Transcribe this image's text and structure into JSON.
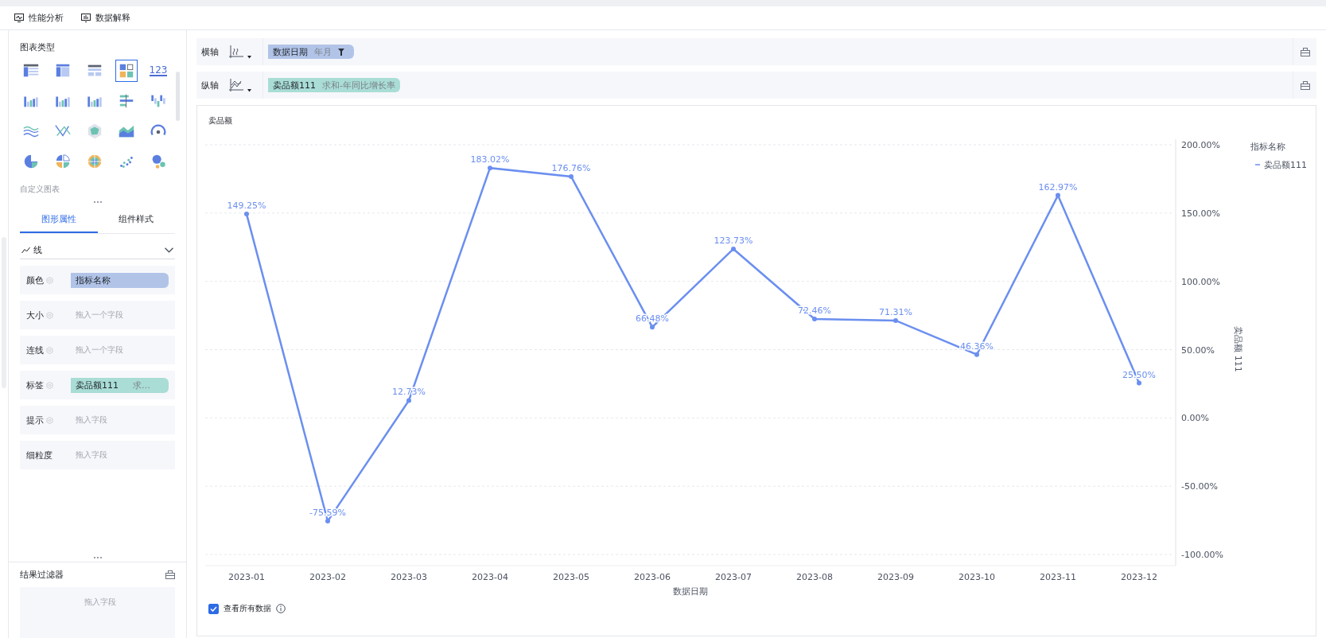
{
  "toolbar": [
    {
      "kind": "performance",
      "label": "性能分析"
    },
    {
      "kind": "explain",
      "label": "数据解释"
    }
  ],
  "chart_types": {
    "title": "图表类型",
    "items": [
      {
        "kind": "table",
        "selected": false
      },
      {
        "kind": "cross-table",
        "selected": false
      },
      {
        "kind": "detail-table",
        "selected": false
      },
      {
        "kind": "card",
        "selected": true
      },
      {
        "kind": "number",
        "label": "123",
        "selected": false
      },
      {
        "kind": "bar-group",
        "selected": false
      },
      {
        "kind": "bar-stack",
        "selected": false
      },
      {
        "kind": "column",
        "selected": false
      },
      {
        "kind": "bar-h",
        "selected": false
      },
      {
        "kind": "waterfall",
        "selected": false
      },
      {
        "kind": "wave",
        "selected": false
      },
      {
        "kind": "line-cross",
        "selected": false
      },
      {
        "kind": "radar",
        "selected": false
      },
      {
        "kind": "area",
        "selected": false
      },
      {
        "kind": "gauge",
        "selected": false
      },
      {
        "kind": "pie",
        "selected": false
      },
      {
        "kind": "split-pie",
        "selected": false
      },
      {
        "kind": "rose",
        "selected": false
      },
      {
        "kind": "scatter",
        "selected": false
      },
      {
        "kind": "bubble",
        "selected": false
      }
    ],
    "custom_label": "自定义图表"
  },
  "tabs": [
    {
      "label": "图形属性",
      "selected": true
    },
    {
      "label": "组件样式",
      "selected": false
    }
  ],
  "mark_type": {
    "label": "线"
  },
  "properties": [
    {
      "label": "颜色",
      "settings": true,
      "pill": {
        "text": "指标名称",
        "color": "#b1c4e8"
      }
    },
    {
      "label": "大小",
      "settings": true,
      "placeholder": "拖入一个字段"
    },
    {
      "label": "连线",
      "settings": true,
      "placeholder": "拖入一个字段"
    },
    {
      "label": "标签",
      "settings": true,
      "pill": {
        "text": "卖品额111",
        "suffix": "求…",
        "color": "#a9ddd6"
      }
    },
    {
      "label": "提示",
      "settings": true,
      "placeholder": "拖入字段"
    },
    {
      "label": "细粒度",
      "settings": false,
      "placeholder": "拖入字段"
    }
  ],
  "result_filter": {
    "title": "结果过滤器",
    "placeholder": "拖入字段"
  },
  "axes": [
    {
      "label": "横轴",
      "kind": "x",
      "field": {
        "name": "数据日期",
        "detail": "年月",
        "color": "#b1c4e8",
        "filter": true
      }
    },
    {
      "label": "纵轴",
      "kind": "y",
      "field": {
        "name": "卖品额111",
        "detail": "求和-年同比增长率",
        "color": "#a9ddd6",
        "filter": false
      }
    }
  ],
  "chart": {
    "title": "卖品额",
    "legend_title": "指标名称",
    "chart_data": {
      "type": "line",
      "xlabel": "数据日期",
      "ylabel": "卖品额 111",
      "categories": [
        "2023-01",
        "2023-02",
        "2023-03",
        "2023-04",
        "2023-05",
        "2023-06",
        "2023-07",
        "2023-08",
        "2023-09",
        "2023-10",
        "2023-11",
        "2023-12"
      ],
      "series": [
        {
          "name": "卖品额111",
          "color": "#6b8ff0",
          "marker": true,
          "values": [
            149.25,
            -75.59,
            12.73,
            183.02,
            176.76,
            66.48,
            123.73,
            72.46,
            71.31,
            46.36,
            162.97,
            25.5
          ]
        }
      ],
      "value_labels": [
        "149.25%",
        "-75.59%",
        "12.73%",
        "183.02%",
        "176.76%",
        "66.48%",
        "123.73%",
        "72.46%",
        "71.31%",
        "46.36%",
        "162.97%",
        "25.50%"
      ],
      "grid": true,
      "ylim": [
        -100,
        200
      ],
      "yticks": [
        {
          "value": -100,
          "label": "-100.00%"
        },
        {
          "value": -50,
          "label": "-50.00%"
        },
        {
          "value": 0,
          "label": "0.00%"
        },
        {
          "value": 50,
          "label": "50.00%"
        },
        {
          "value": 100,
          "label": "100.00%"
        },
        {
          "value": 150,
          "label": "150.00%"
        },
        {
          "value": 200,
          "label": "200.00%"
        }
      ],
      "data_labels": false
    },
    "show_all": {
      "label": "查看所有数据",
      "checked": true
    }
  }
}
